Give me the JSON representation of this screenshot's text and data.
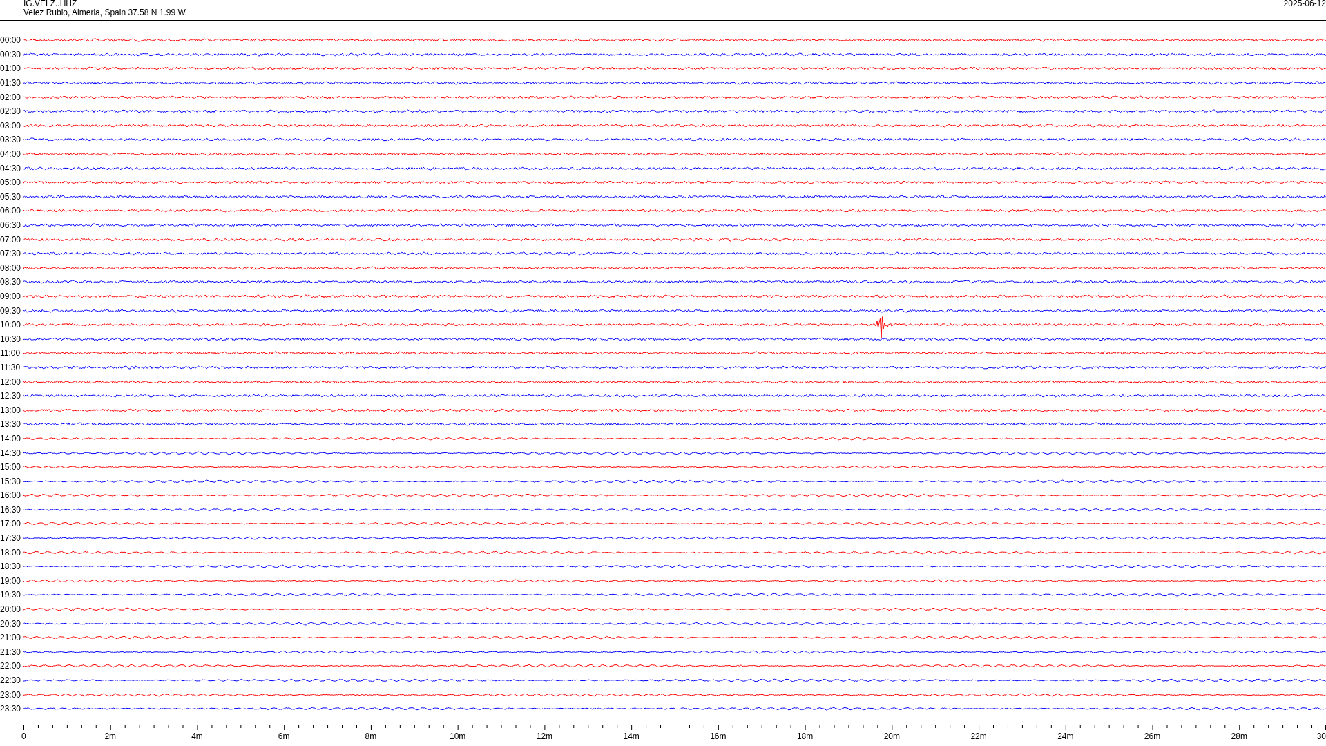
{
  "header": {
    "station": "IG.VELZ..HHZ",
    "location": "Velez Rubio, Almeria, Spain  37.58 N 1.99 W",
    "date": "2025-06-12"
  },
  "rows": [
    {
      "time": "00:00",
      "color": "#ff0000",
      "event": false
    },
    {
      "time": "00:30",
      "color": "#0000ff",
      "event": false
    },
    {
      "time": "01:00",
      "color": "#ff0000",
      "event": false
    },
    {
      "time": "01:30",
      "color": "#0000ff",
      "event": false
    },
    {
      "time": "02:00",
      "color": "#ff0000",
      "event": false
    },
    {
      "time": "02:30",
      "color": "#0000ff",
      "event": false
    },
    {
      "time": "03:00",
      "color": "#ff0000",
      "event": false
    },
    {
      "time": "03:30",
      "color": "#0000ff",
      "event": false
    },
    {
      "time": "04:00",
      "color": "#ff0000",
      "event": false
    },
    {
      "time": "04:30",
      "color": "#0000ff",
      "event": false
    },
    {
      "time": "05:00",
      "color": "#ff0000",
      "event": false
    },
    {
      "time": "05:30",
      "color": "#0000ff",
      "event": false
    },
    {
      "time": "06:00",
      "color": "#ff0000",
      "event": false
    },
    {
      "time": "06:30",
      "color": "#0000ff",
      "event": false
    },
    {
      "time": "07:00",
      "color": "#ff0000",
      "event": false
    },
    {
      "time": "07:30",
      "color": "#0000ff",
      "event": false
    },
    {
      "time": "08:00",
      "color": "#ff0000",
      "event": false
    },
    {
      "time": "08:30",
      "color": "#0000ff",
      "event": false
    },
    {
      "time": "09:00",
      "color": "#ff0000",
      "event": false
    },
    {
      "time": "09:30",
      "color": "#0000ff",
      "event": false
    },
    {
      "time": "10:00",
      "color": "#ff0000",
      "event": true
    },
    {
      "time": "10:30",
      "color": "#0000ff",
      "event": false
    },
    {
      "time": "11:00",
      "color": "#ff0000",
      "event": false
    },
    {
      "time": "11:30",
      "color": "#0000ff",
      "event": false
    },
    {
      "time": "12:00",
      "color": "#ff0000",
      "event": false
    },
    {
      "time": "12:30",
      "color": "#0000ff",
      "event": false
    },
    {
      "time": "13:00",
      "color": "#ff0000",
      "event": false
    },
    {
      "time": "13:30",
      "color": "#0000ff",
      "event": false
    },
    {
      "time": "14:00",
      "color": "#ff0000",
      "event": false
    },
    {
      "time": "14:30",
      "color": "#0000ff",
      "event": false
    },
    {
      "time": "15:00",
      "color": "#ff0000",
      "event": false
    },
    {
      "time": "15:30",
      "color": "#0000ff",
      "event": false
    },
    {
      "time": "16:00",
      "color": "#ff0000",
      "event": false
    },
    {
      "time": "16:30",
      "color": "#0000ff",
      "event": false
    },
    {
      "time": "17:00",
      "color": "#ff0000",
      "event": false
    },
    {
      "time": "17:30",
      "color": "#0000ff",
      "event": false
    },
    {
      "time": "18:00",
      "color": "#ff0000",
      "event": false
    },
    {
      "time": "18:30",
      "color": "#0000ff",
      "event": false
    },
    {
      "time": "19:00",
      "color": "#ff0000",
      "event": false
    },
    {
      "time": "19:30",
      "color": "#0000ff",
      "event": false
    },
    {
      "time": "20:00",
      "color": "#ff0000",
      "event": false
    },
    {
      "time": "20:30",
      "color": "#0000ff",
      "event": false
    },
    {
      "time": "21:00",
      "color": "#ff0000",
      "event": false
    },
    {
      "time": "21:30",
      "color": "#0000ff",
      "event": false
    },
    {
      "time": "22:00",
      "color": "#ff0000",
      "event": false
    },
    {
      "time": "22:30",
      "color": "#0000ff",
      "event": false
    },
    {
      "time": "23:00",
      "color": "#ff0000",
      "event": false
    },
    {
      "time": "23:30",
      "color": "#0000ff",
      "event": false
    }
  ],
  "time_axis": {
    "labels": [
      "0",
      "2m",
      "4m",
      "6m",
      "8m",
      "10m",
      "12m",
      "14m",
      "16m",
      "18m",
      "20m",
      "22m",
      "24m",
      "26m",
      "28m",
      "30"
    ]
  }
}
